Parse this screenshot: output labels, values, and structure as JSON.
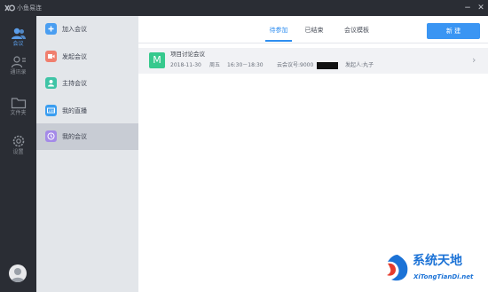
{
  "window": {
    "app_title": "小鱼易连",
    "minimize_glyph": "−",
    "close_glyph": "✕"
  },
  "nav": {
    "items": [
      {
        "label": "会议",
        "icon": "people-icon",
        "active": true
      },
      {
        "label": "通讯录",
        "icon": "contacts-icon",
        "active": false
      },
      {
        "label": "文件夹",
        "icon": "folder-icon",
        "active": false
      },
      {
        "label": "设置",
        "icon": "gear-icon",
        "active": false
      }
    ]
  },
  "menu": {
    "items": [
      {
        "label": "加入会议",
        "icon": "join-icon",
        "color": "#4a9ef1"
      },
      {
        "label": "发起会议",
        "icon": "start-icon",
        "color": "#f07f6e"
      },
      {
        "label": "主持会议",
        "icon": "host-icon",
        "color": "#3fc4a6"
      },
      {
        "label": "我的直播",
        "icon": "live-icon",
        "color": "#3a9df0"
      },
      {
        "label": "我的会议",
        "icon": "clock-icon",
        "color": "#a48ae8"
      }
    ],
    "active_index": 4
  },
  "tabs": [
    {
      "label": "待参加",
      "active": true
    },
    {
      "label": "已结束",
      "active": false
    },
    {
      "label": "会议模板",
      "active": false
    }
  ],
  "new_button_label": "新 建",
  "meeting": {
    "icon_letter": "M",
    "title": "项目讨论会议",
    "date": "2018-11-30",
    "weekday": "周五",
    "time": "16:30－18:30",
    "cloud_id_label": "云会议号:9000",
    "initiator": "发起人:丸子",
    "chevron": "›"
  },
  "watermark": {
    "line1": "系统天地",
    "line2": "XiTongTianDi.net"
  },
  "colors": {
    "sidebar": "#2a2d34",
    "accent": "#2f8ef0",
    "menu_bg": "#e3e6ea",
    "menu_active": "#c8ccd4",
    "meeting_green": "#36c98d"
  }
}
